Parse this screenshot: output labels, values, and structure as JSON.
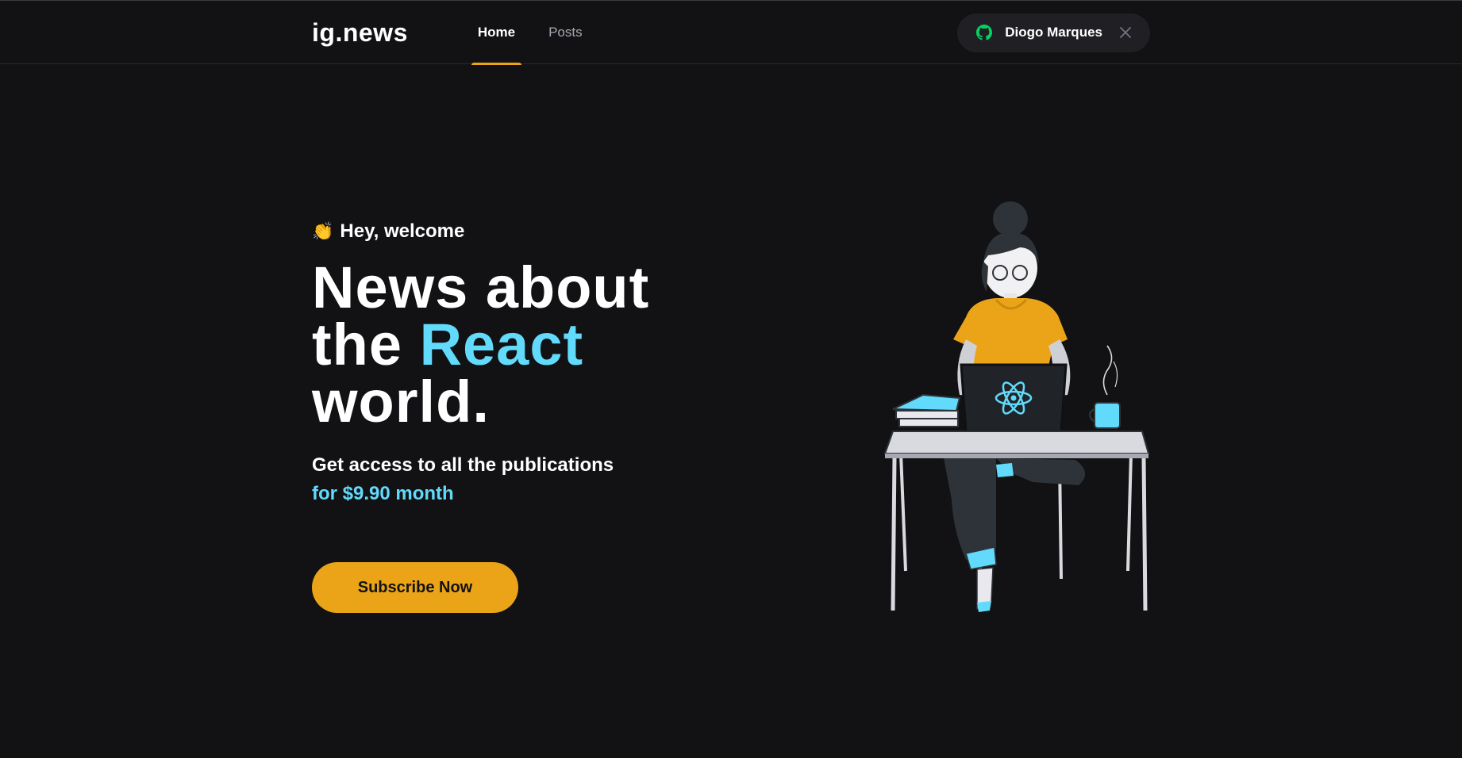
{
  "header": {
    "logo": "ig.news",
    "nav": [
      {
        "label": "Home",
        "active": true
      },
      {
        "label": "Posts",
        "active": false
      }
    ],
    "user": {
      "name": "Diogo Marques",
      "icon": "github-icon",
      "close_icon": "close-icon"
    }
  },
  "hero": {
    "welcome_icon": "clapping-hands-icon",
    "welcome": "Hey, welcome",
    "headline_line1": "News about",
    "headline_line2_prefix": "the",
    "headline_accent": "React",
    "headline_line3": "world.",
    "subtitle": "Get access to all the publications",
    "price": "for $9.90 month",
    "cta": "Subscribe Now"
  },
  "colors": {
    "background": "#121214",
    "accent_yellow": "#eba417",
    "accent_cyan": "#61dafb",
    "github_green": "#04d361"
  }
}
